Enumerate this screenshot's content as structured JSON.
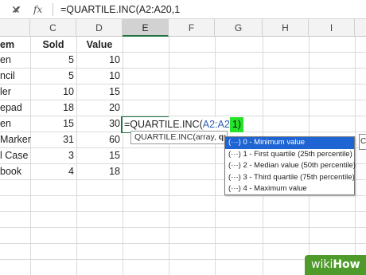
{
  "formula_bar": {
    "cancel_icon": "✕",
    "confirm_icon": "✓",
    "fx_icon": "fx",
    "formula_text": "=QUARTILE.INC(A2:A20,1"
  },
  "columns": [
    "C",
    "D",
    "E",
    "F",
    "G",
    "H",
    "I"
  ],
  "headers": {
    "item": "em",
    "sold": "Sold",
    "value": "Value"
  },
  "rows": [
    {
      "item": "en",
      "sold": "5",
      "value": "10"
    },
    {
      "item": "ncil",
      "sold": "5",
      "value": "10"
    },
    {
      "item": "ler",
      "sold": "10",
      "value": "15"
    },
    {
      "item": "epad",
      "sold": "18",
      "value": "20"
    },
    {
      "item": "en",
      "sold": "15",
      "value": "30"
    },
    {
      "item": "Marker",
      "sold": "31",
      "value": "60"
    },
    {
      "item": "l Case",
      "sold": "3",
      "value": "15"
    },
    {
      "item": "book",
      "sold": "4",
      "value": "18"
    }
  ],
  "edit_cell": {
    "prefix": "=QUARTILE.INC(",
    "range": "A2:A2",
    "highlight": "1)"
  },
  "tooltip": {
    "text": "QUARTILE.INC(array, ",
    "bold": "quar"
  },
  "dropdown": {
    "items": [
      "(···) 0 - Minimum value",
      "(···) 1 - First quartile (25th percentile)",
      "(···) 2 - Median value (50th percentile)",
      "(···) 3 - Third quartile (75th percentile)",
      "(···) 4 - Maximum value"
    ],
    "selected_index": 0
  },
  "edge_box_text": "C",
  "watermark": {
    "part1": "wiki",
    "part2": "How"
  },
  "colors": {
    "accent_green": "#217346",
    "highlight_green": "#25e326",
    "selection_blue": "#1e64d2",
    "watermark_green": "#4e9a2a"
  }
}
